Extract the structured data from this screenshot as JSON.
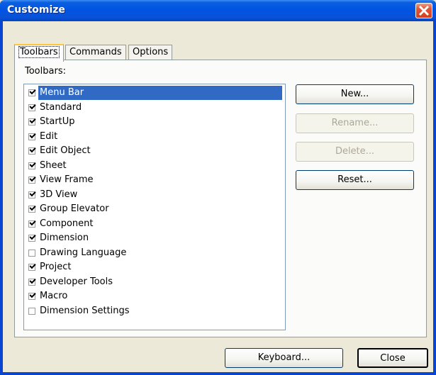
{
  "window": {
    "title": "Customize"
  },
  "tabs": [
    {
      "label": "Toolbars",
      "active": true
    },
    {
      "label": "Commands",
      "active": false
    },
    {
      "label": "Options",
      "active": false
    }
  ],
  "toolbars_panel": {
    "list_label": "Toolbars:",
    "items": [
      {
        "label": "Menu Bar",
        "checked": true,
        "selected": true
      },
      {
        "label": "Standard",
        "checked": true
      },
      {
        "label": "StartUp",
        "checked": true
      },
      {
        "label": "Edit",
        "checked": true
      },
      {
        "label": "Edit Object",
        "checked": true
      },
      {
        "label": "Sheet",
        "checked": true
      },
      {
        "label": "View Frame",
        "checked": true
      },
      {
        "label": "3D View",
        "checked": true
      },
      {
        "label": "Group Elevator",
        "checked": true
      },
      {
        "label": "Component",
        "checked": true
      },
      {
        "label": "Dimension",
        "checked": true
      },
      {
        "label": "Drawing Language",
        "checked": false
      },
      {
        "label": "Project",
        "checked": true
      },
      {
        "label": "Developer Tools",
        "checked": true
      },
      {
        "label": "Macro",
        "checked": true
      },
      {
        "label": "Dimension Settings",
        "checked": false
      }
    ],
    "buttons": {
      "new": "New...",
      "rename": "Rename...",
      "delete": "Delete...",
      "reset": "Reset..."
    }
  },
  "footer": {
    "keyboard": "Keyboard...",
    "close": "Close"
  },
  "colors": {
    "title_bar": "#0054e3",
    "selection": "#316ac5",
    "close_button": "#e0573a"
  },
  "icons": {
    "close": "close-icon",
    "checkbox_tick": "checkmark-icon"
  }
}
